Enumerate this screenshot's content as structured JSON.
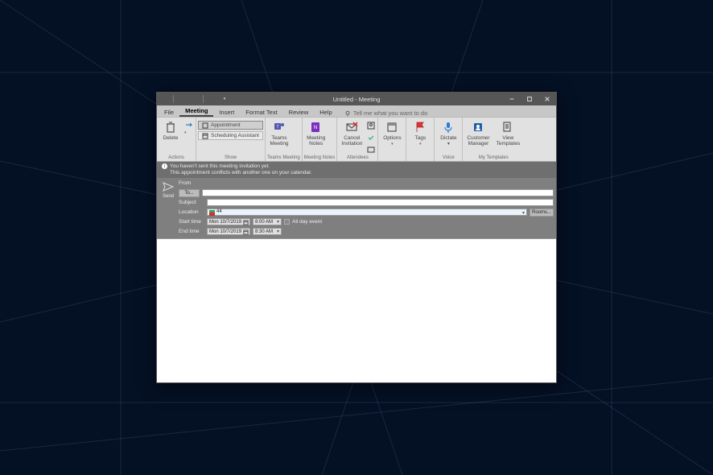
{
  "window": {
    "title": "Untitled  -  Meeting"
  },
  "tabs": {
    "file": "File",
    "meeting": "Meeting",
    "insert": "Insert",
    "format_text": "Format Text",
    "review": "Review",
    "help": "Help",
    "tellme": "Tell me what you want to do"
  },
  "ribbon": {
    "actions": {
      "delete": "Delete",
      "group": "Actions"
    },
    "show": {
      "appointment": "Appointment",
      "scheduling": "Scheduling Assistant",
      "group": "Show"
    },
    "teams": {
      "label": "Teams\nMeeting",
      "group": "Teams Meeting"
    },
    "notes": {
      "label": "Meeting\nNotes",
      "group": "Meeting Notes"
    },
    "attendees": {
      "cancel": "Cancel\nInvitation",
      "group": "Attendees"
    },
    "options": {
      "label": "Options",
      "group": ""
    },
    "tags": {
      "label": "Tags",
      "group": ""
    },
    "voice": {
      "label": "Dictate",
      "group": "Voice"
    },
    "customer": {
      "label": "Customer\nManager"
    },
    "templates": {
      "label": "View\nTemplates",
      "group": "My Templates"
    }
  },
  "notice": {
    "line1": "You haven't sent this meeting invitation yet.",
    "line2": "This appointment conflicts with another one on your calendar."
  },
  "fields": {
    "send": "Send",
    "from": "From",
    "to": "To...",
    "subject": "Subject",
    "location": "Location",
    "location_value": "44",
    "rooms": "Rooms...",
    "start": "Start time",
    "start_date": "Mon 10/7/2019",
    "start_time": "8:00 AM",
    "allday": "All day event",
    "end": "End time",
    "end_date": "Mon 10/7/2019",
    "end_time": "8:30 AM"
  }
}
